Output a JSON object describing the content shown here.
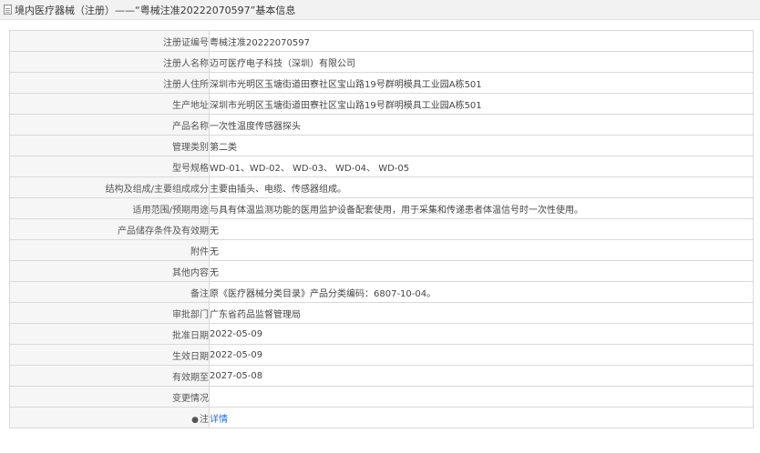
{
  "header": {
    "title": "境内医疗器械（注册）——“粤械注准20222070597”基本信息",
    "icon": "document-icon"
  },
  "rows": [
    {
      "label": "注册证编号",
      "value": "粤械注准20222070597"
    },
    {
      "label": "注册人名称",
      "value": "迈可医疗电子科技（深圳）有限公司"
    },
    {
      "label": "注册人住所",
      "value": "深圳市光明区玉塘街道田寮社区宝山路19号群明模具工业园A栋501"
    },
    {
      "label": "生产地址",
      "value": "深圳市光明区玉塘街道田寮社区宝山路19号群明模具工业园A栋501"
    },
    {
      "label": "产品名称",
      "value": "一次性温度传感器探头"
    },
    {
      "label": "管理类别",
      "value": "第二类"
    },
    {
      "label": "型号规格",
      "value": "WD-01、WD-02、 WD-03、 WD-04、 WD-05"
    },
    {
      "label": "结构及组成/主要组成成分",
      "value": "主要由插头、电缆、传感器组成。"
    },
    {
      "label": "适用范围/预期用途",
      "value": "与具有体温监测功能的医用监护设备配套使用，用于采集和传递患者体温信号时一次性使用。"
    },
    {
      "label": "产品储存条件及有效期",
      "value": "无"
    },
    {
      "label": "附件",
      "value": "无"
    },
    {
      "label": "其他内容",
      "value": "无"
    },
    {
      "label": "备注",
      "value": "原《医疗器械分类目录》产品分类编码：6807-10-04。"
    },
    {
      "label": "审批部门",
      "value": "广东省药品监督管理局"
    },
    {
      "label": "批准日期",
      "value": "2022-05-09"
    },
    {
      "label": "生效日期",
      "value": "2022-05-09"
    },
    {
      "label": "有效期至",
      "value": "2027-05-08"
    },
    {
      "label": "变更情况",
      "value": ""
    }
  ],
  "note_row": {
    "label": "注",
    "icon": "note-icon",
    "link_text": "详情"
  },
  "colors": {
    "label_bg": "#f6f6f6",
    "border": "#d9d9d9",
    "link": "#2a6fc9"
  }
}
